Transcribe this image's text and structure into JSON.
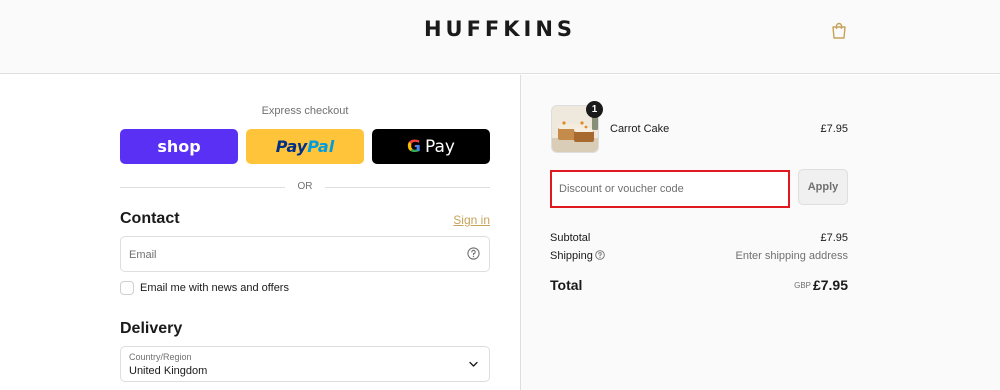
{
  "header": {
    "logo": "HUFFKINS",
    "cart_icon": "shopping-bag-icon"
  },
  "express": {
    "label": "Express checkout",
    "shop_label": "shop",
    "paypal_part1": "Pay",
    "paypal_part2": "Pal",
    "gpay_g": "G",
    "gpay_label": "Pay",
    "or_label": "OR"
  },
  "contact": {
    "title": "Contact",
    "signin_label": "Sign in",
    "email_placeholder": "Email",
    "help_icon": "question-circle-icon",
    "newsletter_label": "Email me with news and offers"
  },
  "delivery": {
    "title": "Delivery",
    "country_label": "Country/Region",
    "country_value": "United Kingdom"
  },
  "order": {
    "quantity": "1",
    "item_name": "Carrot Cake",
    "item_price": "£7.95",
    "discount_placeholder": "Discount or voucher code",
    "apply_label": "Apply",
    "subtotal_label": "Subtotal",
    "subtotal_value": "£7.95",
    "shipping_label": "Shipping",
    "shipping_value": "Enter shipping address",
    "total_label": "Total",
    "total_currency": "GBP",
    "total_value": "£7.95"
  },
  "colors": {
    "accent": "#c6a35a",
    "shop_purple": "#5a31f4",
    "paypal_yellow": "#ffc439",
    "highlight_red": "#e0191f"
  }
}
